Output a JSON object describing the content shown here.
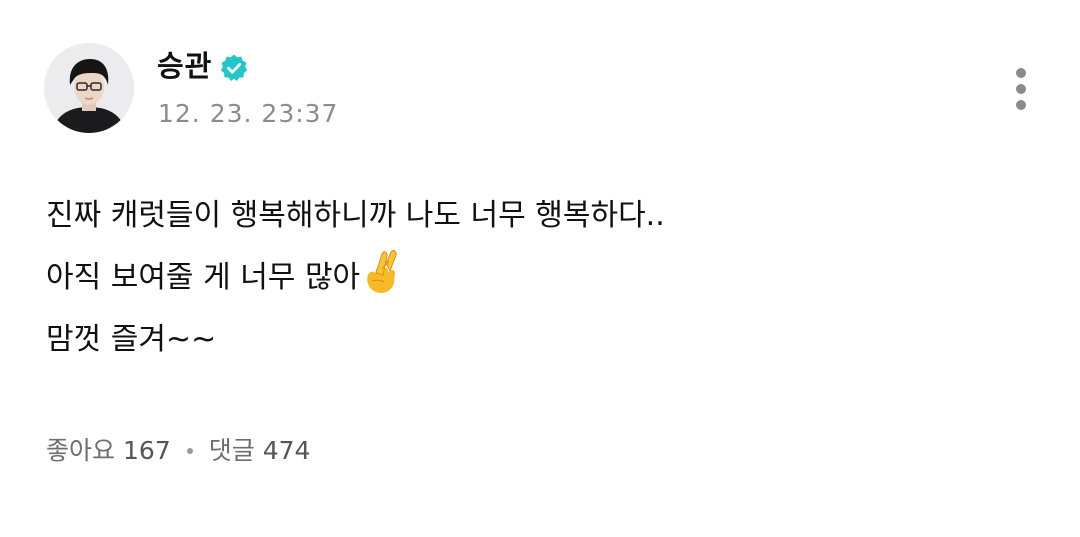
{
  "author": {
    "name": "승관",
    "verified": true,
    "verified_color": "#25c6c9",
    "avatar_icon": "profile-photo"
  },
  "post": {
    "timestamp": "12. 23. 23:37",
    "lines": [
      "진짜 캐럿들이 행복해하니까 나도 너무 행복하다..",
      "아직 보여줄 게 너무 많아",
      "맘껏 즐겨~~"
    ],
    "emoji": "crossed-fingers"
  },
  "stats": {
    "likes_label": "좋아요",
    "likes_count": "167",
    "comments_label": "댓글",
    "comments_count": "474"
  },
  "menu": {
    "icon": "more-vertical-icon"
  }
}
